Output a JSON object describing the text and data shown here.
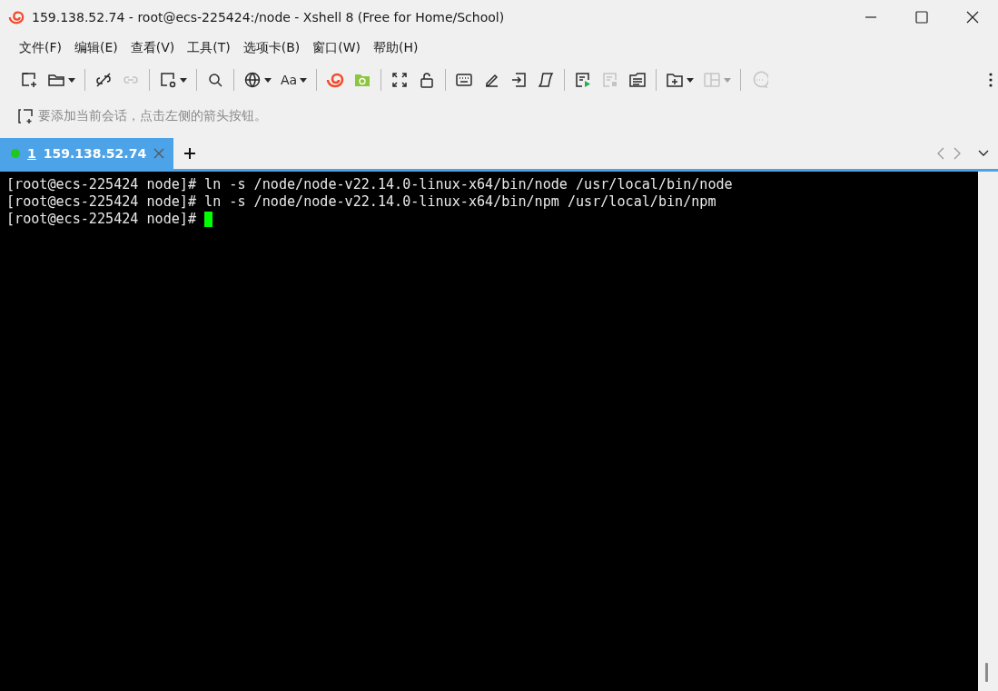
{
  "window": {
    "title": "159.138.52.74 - root@ecs-225424:/node - Xshell 8 (Free for Home/School)"
  },
  "menu": [
    "文件(F)",
    "编辑(E)",
    "查看(V)",
    "工具(T)",
    "选项卡(B)",
    "窗口(W)",
    "帮助(H)"
  ],
  "toolbar": [
    {
      "kind": "button",
      "disabled": false,
      "dropdown": false
    },
    {
      "kind": "button",
      "disabled": false,
      "dropdown": true
    },
    {
      "kind": "separator"
    },
    {
      "kind": "button",
      "disabled": false,
      "dropdown": false
    },
    {
      "kind": "button",
      "disabled": true,
      "dropdown": false
    },
    {
      "kind": "separator"
    },
    {
      "kind": "button",
      "disabled": false,
      "dropdown": true
    },
    {
      "kind": "separator"
    },
    {
      "kind": "button",
      "disabled": false,
      "dropdown": false
    },
    {
      "kind": "separator"
    },
    {
      "kind": "button",
      "disabled": false,
      "dropdown": true
    },
    {
      "kind": "text",
      "label": "Aa",
      "disabled": false,
      "dropdown": true
    },
    {
      "kind": "separator"
    },
    {
      "kind": "button",
      "disabled": false,
      "dropdown": false
    },
    {
      "kind": "button",
      "disabled": false,
      "dropdown": false
    },
    {
      "kind": "separator"
    },
    {
      "kind": "button",
      "disabled": false,
      "dropdown": false
    },
    {
      "kind": "button",
      "disabled": false,
      "dropdown": false
    },
    {
      "kind": "separator"
    },
    {
      "kind": "button",
      "disabled": false,
      "dropdown": false
    },
    {
      "kind": "button",
      "disabled": false,
      "dropdown": false
    },
    {
      "kind": "button",
      "disabled": false,
      "dropdown": false
    },
    {
      "kind": "button",
      "disabled": false,
      "dropdown": false
    },
    {
      "kind": "separator"
    },
    {
      "kind": "button",
      "disabled": false,
      "dropdown": false
    },
    {
      "kind": "button",
      "disabled": true,
      "dropdown": false
    },
    {
      "kind": "button",
      "disabled": false,
      "dropdown": false
    },
    {
      "kind": "separator"
    },
    {
      "kind": "button",
      "disabled": false,
      "dropdown": true
    },
    {
      "kind": "button",
      "disabled": true,
      "dropdown": true
    },
    {
      "kind": "separator"
    },
    {
      "kind": "button",
      "disabled": true,
      "dropdown": false
    }
  ],
  "session_bar": {
    "hint": "要添加当前会话，点击左侧的箭头按钮。"
  },
  "tabs": [
    {
      "number": "1",
      "label": "159.138.52.74",
      "selected": true,
      "connected": true
    }
  ],
  "terminal": {
    "lines": [
      {
        "text": "[root@ecs-225424 node]# ln -s /node/node-v22.14.0-linux-x64/bin/node /usr/local/bin/node",
        "cursor": false
      },
      {
        "text": "[root@ecs-225424 node]# ln -s /node/node-v22.14.0-linux-x64/bin/npm /usr/local/bin/npm",
        "cursor": false
      },
      {
        "text": "[root@ecs-225424 node]# ",
        "cursor": true
      }
    ]
  }
}
